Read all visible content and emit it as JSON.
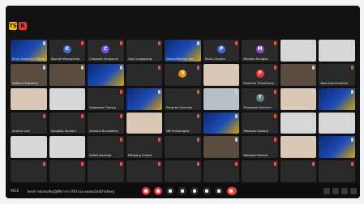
{
  "top": {
    "badges": [
      {
        "id": "badge-yellow",
        "label": "TS",
        "color": "#f2c200"
      },
      {
        "id": "badge-red",
        "label": "R",
        "color": "#e53935"
      }
    ]
  },
  "tiles": [
    {
      "name": "Khun Somchai / Office",
      "style": "blue",
      "avatar": "",
      "avatar_color": "",
      "mic": "on"
    },
    {
      "name": "Boondit Wangsrisilp",
      "style": "",
      "avatar": "K",
      "avatar_color": "#3f6ad8",
      "mic": "off"
    },
    {
      "name": "Chayawit Simpanya",
      "style": "",
      "avatar": "C",
      "avatar_color": "#7b4ae2",
      "mic": "off"
    },
    {
      "name": "Gap Lungapaing",
      "style": "",
      "avatar": "",
      "avatar_color": "",
      "mic": "off"
    },
    {
      "name": "ApirakPatheng Rat",
      "style": "blue",
      "avatar": "",
      "avatar_color": "",
      "mic": "on"
    },
    {
      "name": "Pachu Chasen",
      "style": "",
      "avatar": "P",
      "avatar_color": "#3f6ad8",
      "mic": "off"
    },
    {
      "name": "Montien Rungtan",
      "style": "",
      "avatar": "M",
      "avatar_color": "#8a49c8",
      "mic": "off"
    },
    {
      "name": "",
      "style": "white",
      "avatar": "",
      "avatar_color": "",
      "mic": "on"
    },
    {
      "name": "",
      "style": "white",
      "avatar": "",
      "avatar_color": "",
      "mic": "on"
    },
    {
      "name": "Netiwut Sawaeng",
      "style": "photo",
      "avatar": "",
      "avatar_color": "",
      "mic": "on"
    },
    {
      "name": "",
      "style": "photo",
      "avatar": "",
      "avatar_color": "",
      "mic": "on"
    },
    {
      "name": "",
      "style": "blue",
      "avatar": "",
      "avatar_color": "",
      "mic": "on"
    },
    {
      "name": "",
      "style": "",
      "avatar": "",
      "avatar_color": "",
      "mic": "off"
    },
    {
      "name": "",
      "style": "",
      "avatar": "S",
      "avatar_color": "#f28c00",
      "mic": "off"
    },
    {
      "name": "",
      "style": "warm",
      "avatar": "",
      "avatar_color": "",
      "mic": "on"
    },
    {
      "name": "Phannee Thamthong",
      "style": "",
      "avatar": "P",
      "avatar_color": "#e53935",
      "mic": "off"
    },
    {
      "name": "",
      "style": "photo",
      "avatar": "",
      "avatar_color": "",
      "mic": "on"
    },
    {
      "name": "Nisa Kanchanathai",
      "style": "",
      "avatar": "",
      "avatar_color": "",
      "mic": "off"
    },
    {
      "name": "",
      "style": "warm",
      "avatar": "",
      "avatar_color": "",
      "mic": "on"
    },
    {
      "name": "",
      "style": "white",
      "avatar": "",
      "avatar_color": "",
      "mic": "on"
    },
    {
      "name": "Saowanee Thanya",
      "style": "",
      "avatar": "",
      "avatar_color": "",
      "mic": "off"
    },
    {
      "name": "",
      "style": "blue",
      "avatar": "",
      "avatar_color": "",
      "mic": "on"
    },
    {
      "name": "Rongrat Chanchai",
      "style": "",
      "avatar": "",
      "avatar_color": "",
      "mic": "off"
    },
    {
      "name": "",
      "style": "office",
      "avatar": "",
      "avatar_color": "",
      "mic": "on"
    },
    {
      "name": "Thanapon Kanchan",
      "style": "",
      "avatar": "T",
      "avatar_color": "#607d8b",
      "mic": "off"
    },
    {
      "name": "Jirawan Pimpanya",
      "style": "warm",
      "avatar": "",
      "avatar_color": "",
      "mic": "on"
    },
    {
      "name": "",
      "style": "blue",
      "avatar": "",
      "avatar_color": "",
      "mic": "on"
    },
    {
      "name": "Ananya Lert",
      "style": "",
      "avatar": "",
      "avatar_color": "",
      "mic": "off"
    },
    {
      "name": "Rungthip Suntorn",
      "style": "",
      "avatar": "",
      "avatar_color": "",
      "mic": "off"
    },
    {
      "name": "Samana Bunsukkha",
      "style": "",
      "avatar": "",
      "avatar_color": "",
      "mic": "off"
    },
    {
      "name": "",
      "style": "warm",
      "avatar": "",
      "avatar_color": "",
      "mic": "on"
    },
    {
      "name": "NB Pruttanapha",
      "style": "",
      "avatar": "",
      "avatar_color": "",
      "mic": "off"
    },
    {
      "name": "",
      "style": "blue",
      "avatar": "",
      "avatar_color": "",
      "mic": "on"
    },
    {
      "name": "Pakawat Chaiwat",
      "style": "",
      "avatar": "",
      "avatar_color": "",
      "mic": "off"
    },
    {
      "name": "",
      "style": "white",
      "avatar": "",
      "avatar_color": "",
      "mic": "on"
    },
    {
      "name": "",
      "style": "white",
      "avatar": "",
      "avatar_color": "",
      "mic": "on"
    },
    {
      "name": "",
      "style": "white",
      "avatar": "",
      "avatar_color": "",
      "mic": "on"
    },
    {
      "name": "",
      "style": "white",
      "avatar": "",
      "avatar_color": "",
      "mic": "on"
    },
    {
      "name": "Saksit Jeamsilp",
      "style": "",
      "avatar": "",
      "avatar_color": "",
      "mic": "off"
    },
    {
      "name": "Kittipong Chaiyo",
      "style": "",
      "avatar": "",
      "avatar_color": "",
      "mic": "off"
    },
    {
      "name": "",
      "style": "",
      "avatar": "",
      "avatar_color": "",
      "mic": "off"
    },
    {
      "name": "",
      "style": "photo",
      "avatar": "",
      "avatar_color": "",
      "mic": "on"
    },
    {
      "name": "Nattapol Meesuk",
      "style": "",
      "avatar": "",
      "avatar_color": "",
      "mic": "off"
    },
    {
      "name": "",
      "style": "warm",
      "avatar": "",
      "avatar_color": "",
      "mic": "on"
    },
    {
      "name": "",
      "style": "blue",
      "avatar": "",
      "avatar_color": "",
      "mic": "on"
    },
    {
      "name": "",
      "style": "",
      "avatar": "",
      "avatar_color": "",
      "mic": "off"
    },
    {
      "name": "",
      "style": "",
      "avatar": "",
      "avatar_color": "",
      "mic": "off"
    },
    {
      "name": "",
      "style": "",
      "avatar": "",
      "avatar_color": "",
      "mic": "off"
    },
    {
      "name": "",
      "style": "",
      "avatar": "",
      "avatar_color": "",
      "mic": "off"
    },
    {
      "name": "",
      "style": "",
      "avatar": "",
      "avatar_color": "",
      "mic": "off"
    },
    {
      "name": "",
      "style": "",
      "avatar": "",
      "avatar_color": "",
      "mic": "off"
    },
    {
      "name": "",
      "style": "",
      "avatar": "",
      "avatar_color": "",
      "mic": "off"
    },
    {
      "name": "",
      "style": "",
      "avatar": "",
      "avatar_color": "",
      "mic": "off"
    },
    {
      "name": "",
      "style": "",
      "avatar": "",
      "avatar_color": "",
      "mic": "off"
    }
  ],
  "bottom": {
    "meeting_id": "9616",
    "meeting_title": "โครงการอบรมเชิงปฏิบัติการการใช้งานระบบออนไลน์สำหรับครู",
    "controls": [
      {
        "id": "mic-control",
        "icon": "mic-icon",
        "variant": "red"
      },
      {
        "id": "camera-control",
        "icon": "camera-icon",
        "variant": "red"
      },
      {
        "id": "share-control",
        "icon": "share-icon",
        "variant": ""
      },
      {
        "id": "emoji-control",
        "icon": "emoji-icon",
        "variant": ""
      },
      {
        "id": "captions-control",
        "icon": "captions-icon",
        "variant": ""
      },
      {
        "id": "raise-hand-control",
        "icon": "hand-icon",
        "variant": ""
      },
      {
        "id": "more-control",
        "icon": "more-icon",
        "variant": ""
      },
      {
        "id": "leave-control",
        "icon": "phone-icon",
        "variant": "leave"
      }
    ],
    "right_icons": [
      "info-icon",
      "participants-icon",
      "chat-icon",
      "activities-icon"
    ]
  }
}
